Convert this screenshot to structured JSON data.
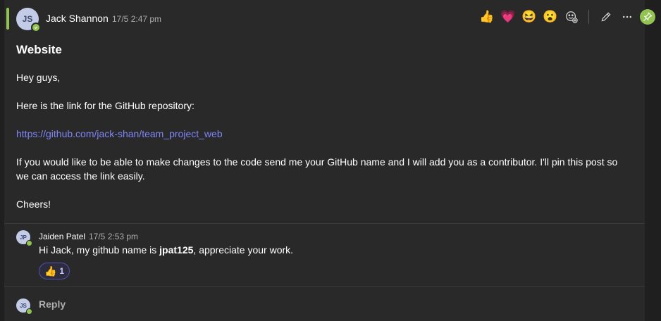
{
  "post": {
    "author": "Jack Shannon",
    "author_initials": "JS",
    "timestamp": "17/5 2:47 pm",
    "subject": "Website",
    "body": {
      "greeting": "Hey guys,",
      "intro": "Here is the link for the GitHub repository:",
      "link": "https://github.com/jack-shan/team_project_web",
      "paragraph_line1": "If you would like to be able to make changes to the code send me your GitHub name and I will add you as a contributor. I'll pin this post so",
      "paragraph_line2": "we can access the link easily.",
      "signoff": "Cheers!"
    }
  },
  "reactions_bar": {
    "like": "👍",
    "heart": "💗",
    "laugh": "😆",
    "surprised": "😮"
  },
  "reply": {
    "author": "Jaiden Patel",
    "author_initials": "JP",
    "timestamp": "17/5 2:53 pm",
    "text_before": "Hi Jack, my github name is ",
    "text_bold": "jpat125",
    "text_after": ", appreciate your work.",
    "reaction_emoji": "👍",
    "reaction_count": "1"
  },
  "reply_box": {
    "user_initials": "JS",
    "label": "Reply"
  },
  "colors": {
    "accent_green": "#92c353",
    "link_purple": "#7f85f5",
    "chip_border": "#4f52b2"
  }
}
